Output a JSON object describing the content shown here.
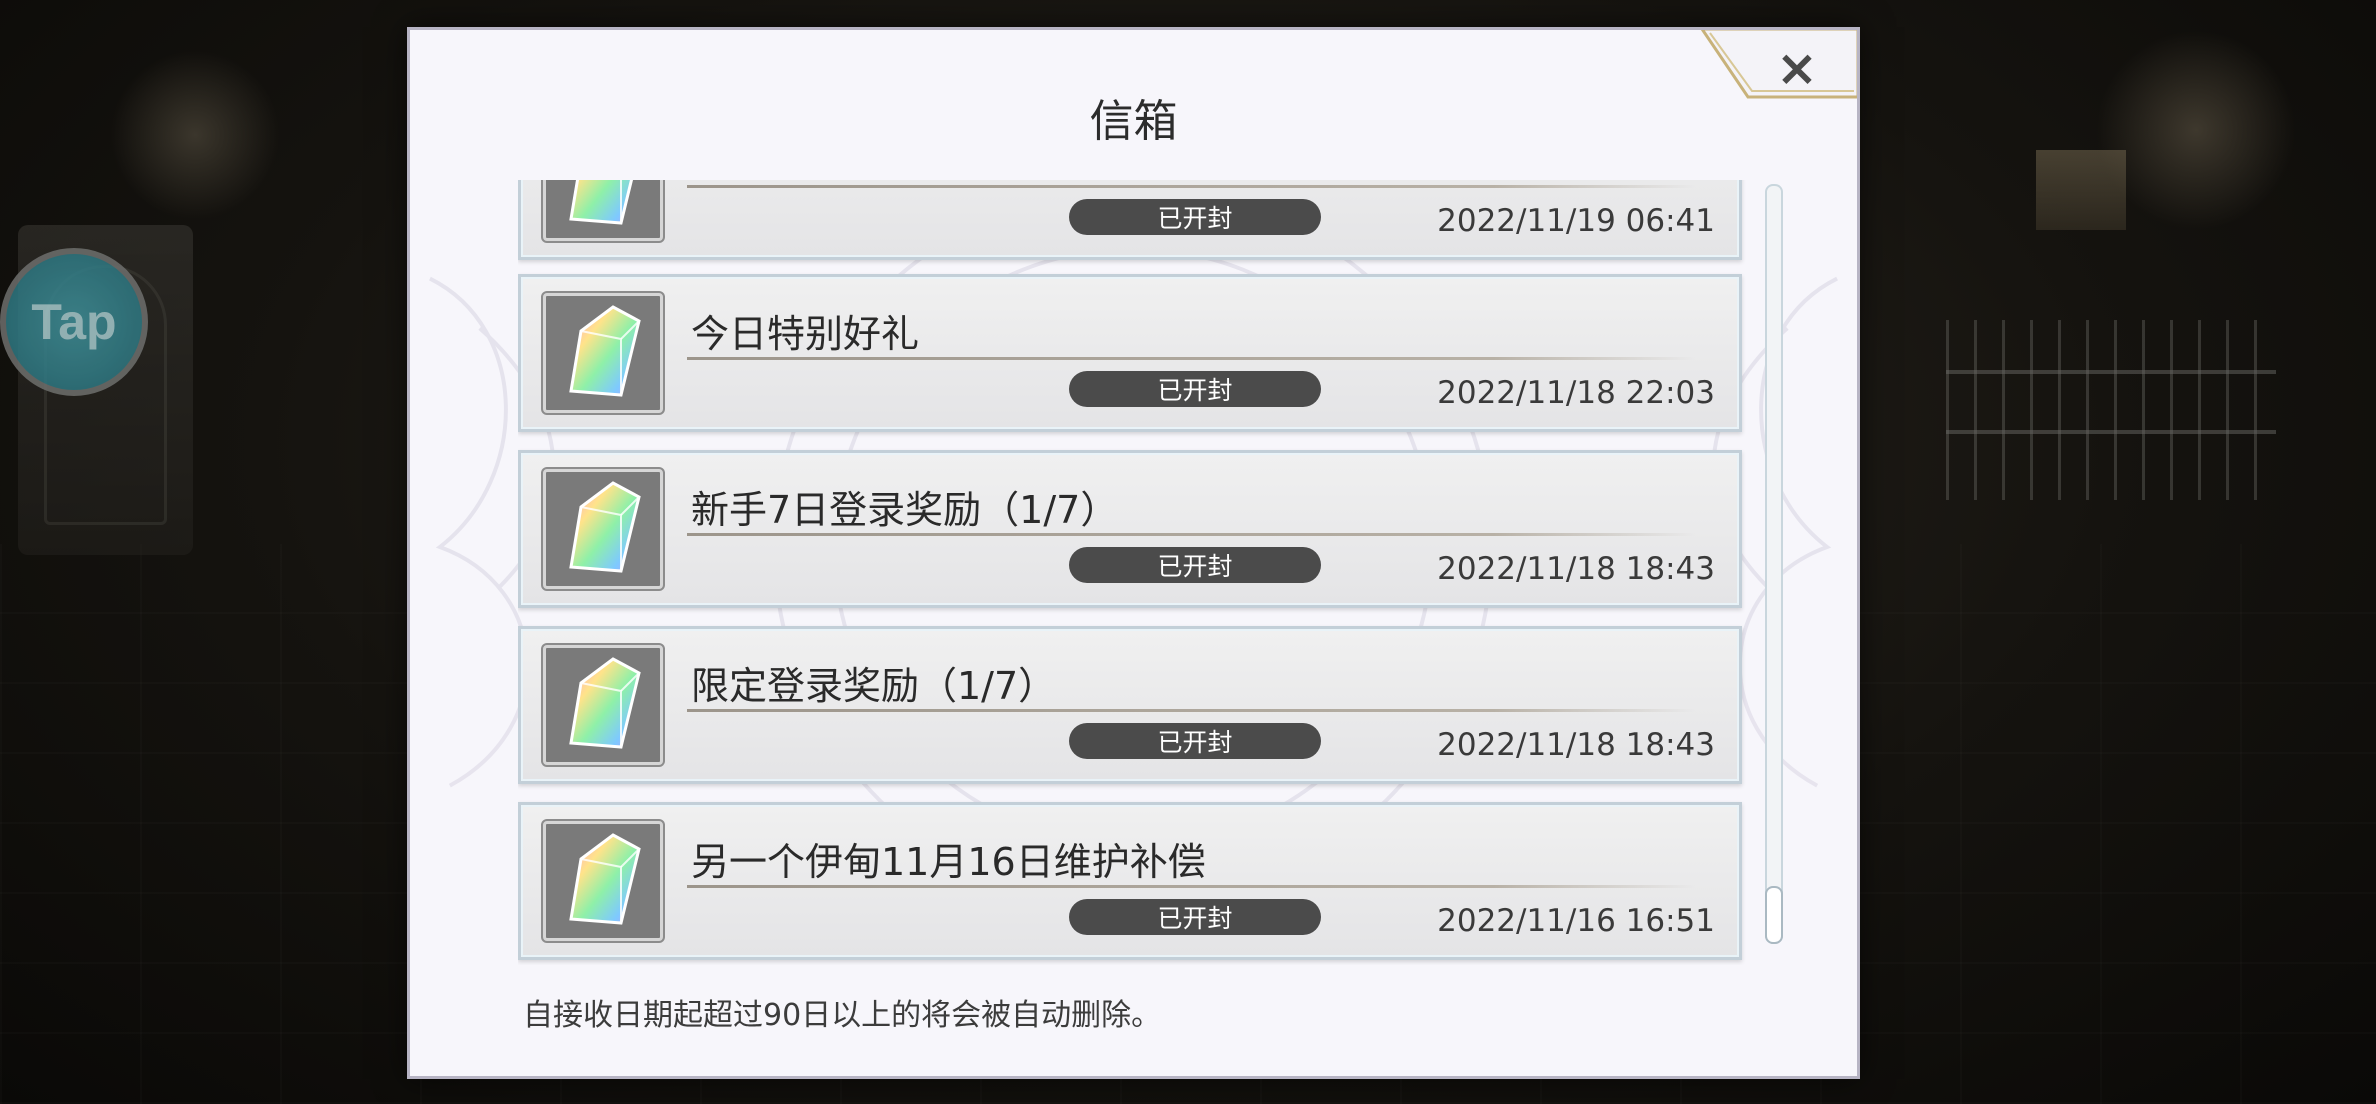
{
  "dialog": {
    "title": "信箱",
    "close_label": "×",
    "footer_note": "自接收日期起超过90日以上的将会被自动删除。"
  },
  "tap_button": {
    "label": "Tap"
  },
  "mails": [
    {
      "title": "",
      "status": "已开封",
      "date": "2022/11/19 06:41"
    },
    {
      "title": "今日特别好礼",
      "status": "已开封",
      "date": "2022/11/18 22:03"
    },
    {
      "title": "新手7日登录奖励（1/7）",
      "status": "已开封",
      "date": "2022/11/18 18:43"
    },
    {
      "title": "限定登录奖励（1/7）",
      "status": "已开封",
      "date": "2022/11/18 18:43"
    },
    {
      "title": "另一个伊甸11月16日维护补偿",
      "status": "已开封",
      "date": "2022/11/16 16:51"
    }
  ],
  "icons": {
    "mail_item_icon": "rainbow-crystal-icon",
    "close": "close-icon"
  },
  "colors": {
    "badge": "#4b4b4b",
    "dialog_bg": "#f7f6fb",
    "tap": "#2f7882"
  }
}
